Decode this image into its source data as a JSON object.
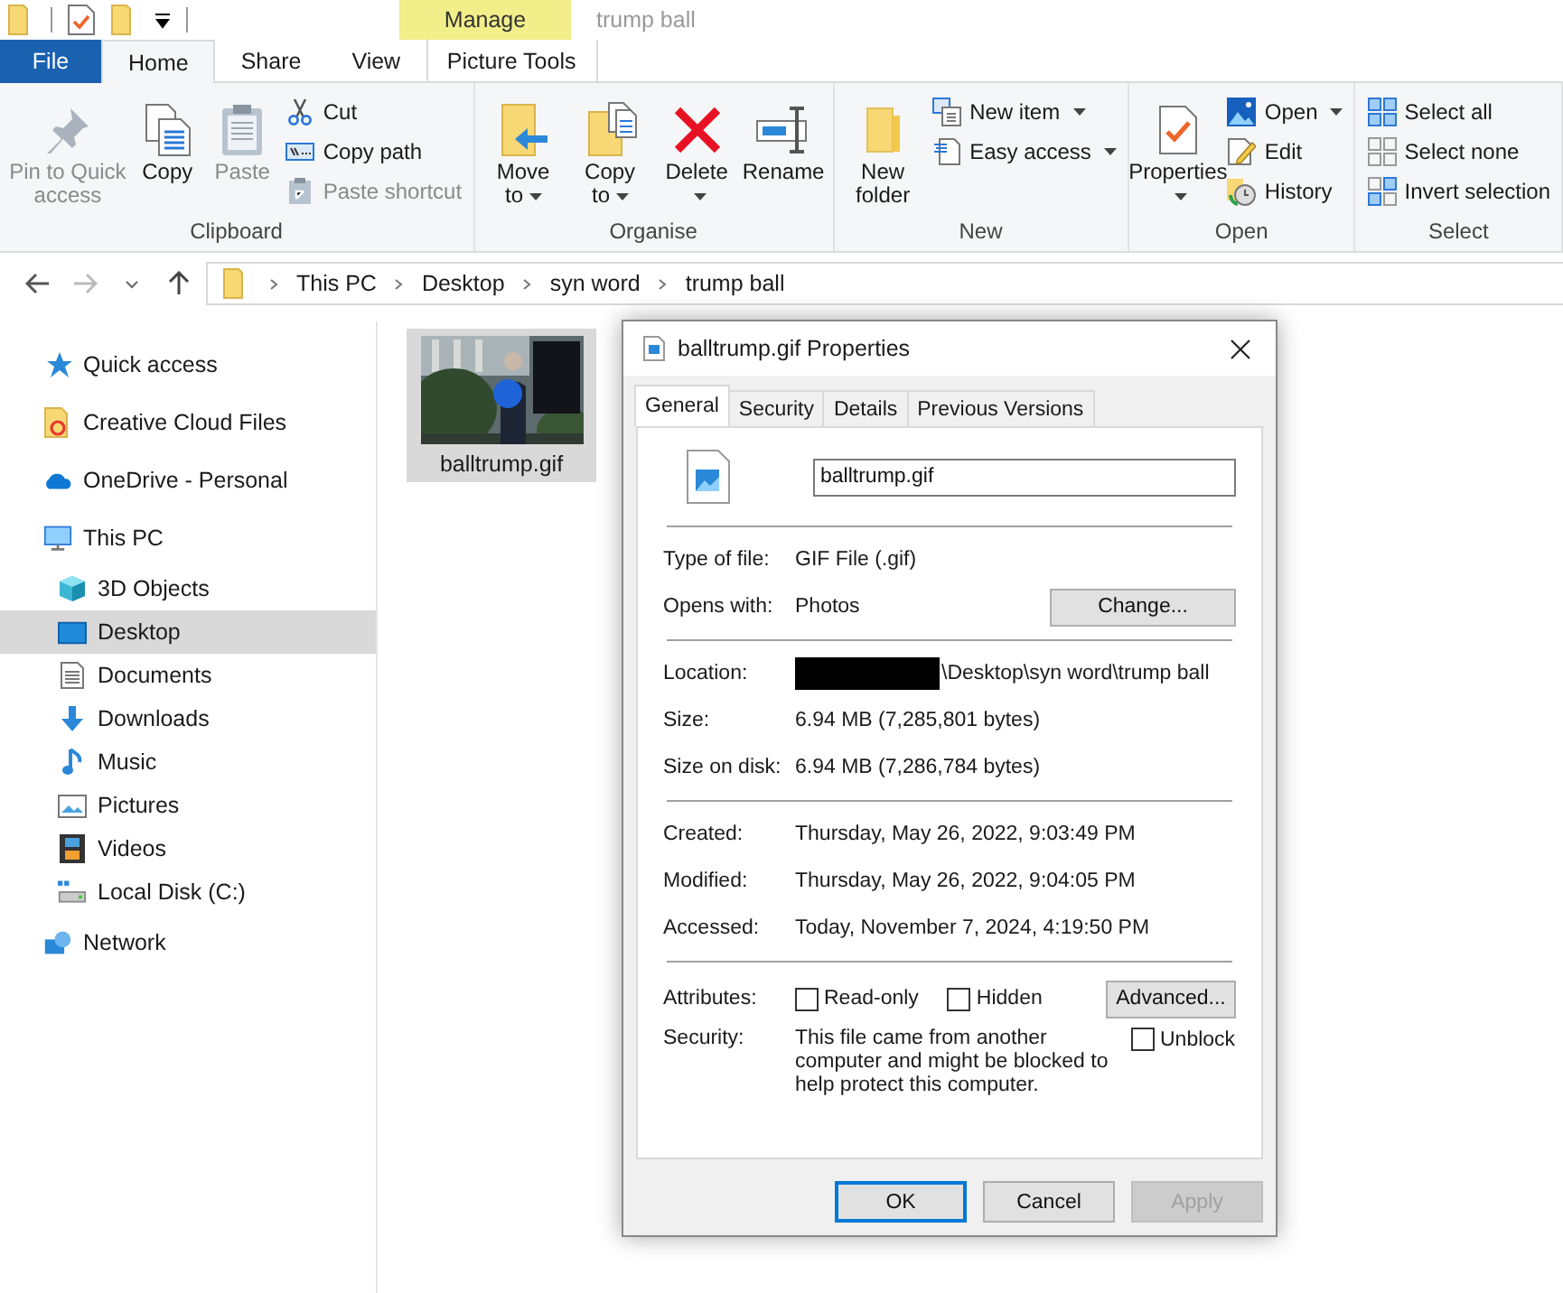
{
  "window": {
    "title": "trump ball",
    "context_group": "Manage"
  },
  "tabs": [
    {
      "label": "File",
      "kind": "file",
      "selected": false
    },
    {
      "label": "Home",
      "kind": "tab",
      "selected": true
    },
    {
      "label": "Share",
      "kind": "tab",
      "selected": false
    },
    {
      "label": "View",
      "kind": "tab",
      "selected": false
    },
    {
      "label": "Picture Tools",
      "kind": "context",
      "selected": false
    }
  ],
  "ribbon": [
    {
      "label": "Clipboard",
      "large": [
        {
          "label": "Pin to Quick access",
          "disabled": true,
          "dropdown": false
        },
        {
          "label": "Copy",
          "disabled": false,
          "dropdown": false
        },
        {
          "label": "Paste",
          "disabled": true,
          "dropdown": false
        }
      ],
      "small": [
        {
          "label": "Cut",
          "disabled": false,
          "dropdown": false
        },
        {
          "label": "Copy path",
          "disabled": false,
          "dropdown": false
        },
        {
          "label": "Paste shortcut",
          "disabled": true,
          "dropdown": false
        }
      ]
    },
    {
      "label": "Organise",
      "large": [
        {
          "label": "Move to",
          "disabled": false,
          "dropdown": true
        },
        {
          "label": "Copy to",
          "disabled": false,
          "dropdown": true
        },
        {
          "label": "Delete",
          "disabled": false,
          "dropdown": true
        },
        {
          "label": "Rename",
          "disabled": false,
          "dropdown": false
        }
      ]
    },
    {
      "label": "New",
      "large": [
        {
          "label": "New folder",
          "disabled": false,
          "dropdown": false
        }
      ],
      "small": [
        {
          "label": "New item",
          "disabled": false,
          "dropdown": true
        },
        {
          "label": "Easy access",
          "disabled": false,
          "dropdown": true
        }
      ]
    },
    {
      "label": "Open",
      "large": [
        {
          "label": "Properties",
          "disabled": false,
          "dropdown": true
        }
      ],
      "small": [
        {
          "label": "Open",
          "disabled": false,
          "dropdown": true
        },
        {
          "label": "Edit",
          "disabled": false,
          "dropdown": false
        },
        {
          "label": "History",
          "disabled": false,
          "dropdown": false
        }
      ]
    },
    {
      "label": "Select",
      "small": [
        {
          "label": "Select all",
          "disabled": false,
          "dropdown": false
        },
        {
          "label": "Select none",
          "disabled": false,
          "dropdown": false
        },
        {
          "label": "Invert selection",
          "disabled": false,
          "dropdown": false
        }
      ]
    }
  ],
  "address": {
    "breadcrumbs": [
      "This PC",
      "Desktop",
      "syn word",
      "trump ball"
    ]
  },
  "sidebar": {
    "items": [
      {
        "label": "Quick access",
        "selected": false
      },
      {
        "label": "Creative Cloud Files",
        "selected": false
      },
      {
        "label": "OneDrive - Personal",
        "selected": false
      },
      {
        "label": "This PC",
        "selected": false,
        "children": [
          {
            "label": "3D Objects",
            "selected": false
          },
          {
            "label": "Desktop",
            "selected": true
          },
          {
            "label": "Documents",
            "selected": false
          },
          {
            "label": "Downloads",
            "selected": false
          },
          {
            "label": "Music",
            "selected": false
          },
          {
            "label": "Pictures",
            "selected": false
          },
          {
            "label": "Videos",
            "selected": false
          },
          {
            "label": "Local Disk (C:)",
            "selected": false
          }
        ]
      },
      {
        "label": "Network",
        "selected": false
      }
    ]
  },
  "files": [
    {
      "name": "balltrump.gif",
      "selected": true,
      "kind": "picture"
    }
  ],
  "dialog": {
    "title": "balltrump.gif Properties",
    "tabs": [
      {
        "label": "General",
        "selected": true
      },
      {
        "label": "Security",
        "selected": false
      },
      {
        "label": "Details",
        "selected": false
      },
      {
        "label": "Previous Versions",
        "selected": false
      }
    ],
    "file_name": "balltrump.gif",
    "sections": [
      [
        {
          "label": "Type of file:",
          "value": "GIF File (.gif)"
        },
        {
          "label": "Opens with:",
          "value": "Photos",
          "button": "Change..."
        }
      ],
      [
        {
          "label": "Location:",
          "value": "\\Desktop\\syn word\\trump ball",
          "redacted": true
        },
        {
          "label": "Size:",
          "value": "6.94 MB (7,285,801 bytes)"
        },
        {
          "label": "Size on disk:",
          "value": "6.94 MB (7,286,784 bytes)"
        }
      ],
      [
        {
          "label": "Created:",
          "value": "Thursday, May 26, 2022, 9:03:49 PM"
        },
        {
          "label": "Modified:",
          "value": "Thursday, May 26, 2022, 9:04:05 PM"
        },
        {
          "label": "Accessed:",
          "value": "Today, November 7, 2024, 4:19:50 PM"
        }
      ]
    ],
    "attributes": {
      "label": "Attributes:",
      "checkboxes": [
        {
          "label": "Read-only",
          "checked": false
        },
        {
          "label": "Hidden",
          "checked": false
        }
      ],
      "button": "Advanced..."
    },
    "security": {
      "label": "Security:",
      "text": "This file came from another computer and might be blocked to help protect this computer.",
      "checkbox": {
        "label": "Unblock",
        "checked": false
      }
    },
    "buttons": [
      {
        "label": "OK",
        "default": true,
        "disabled": false
      },
      {
        "label": "Cancel",
        "default": false,
        "disabled": false
      },
      {
        "label": "Apply",
        "default": false,
        "disabled": true
      }
    ]
  }
}
